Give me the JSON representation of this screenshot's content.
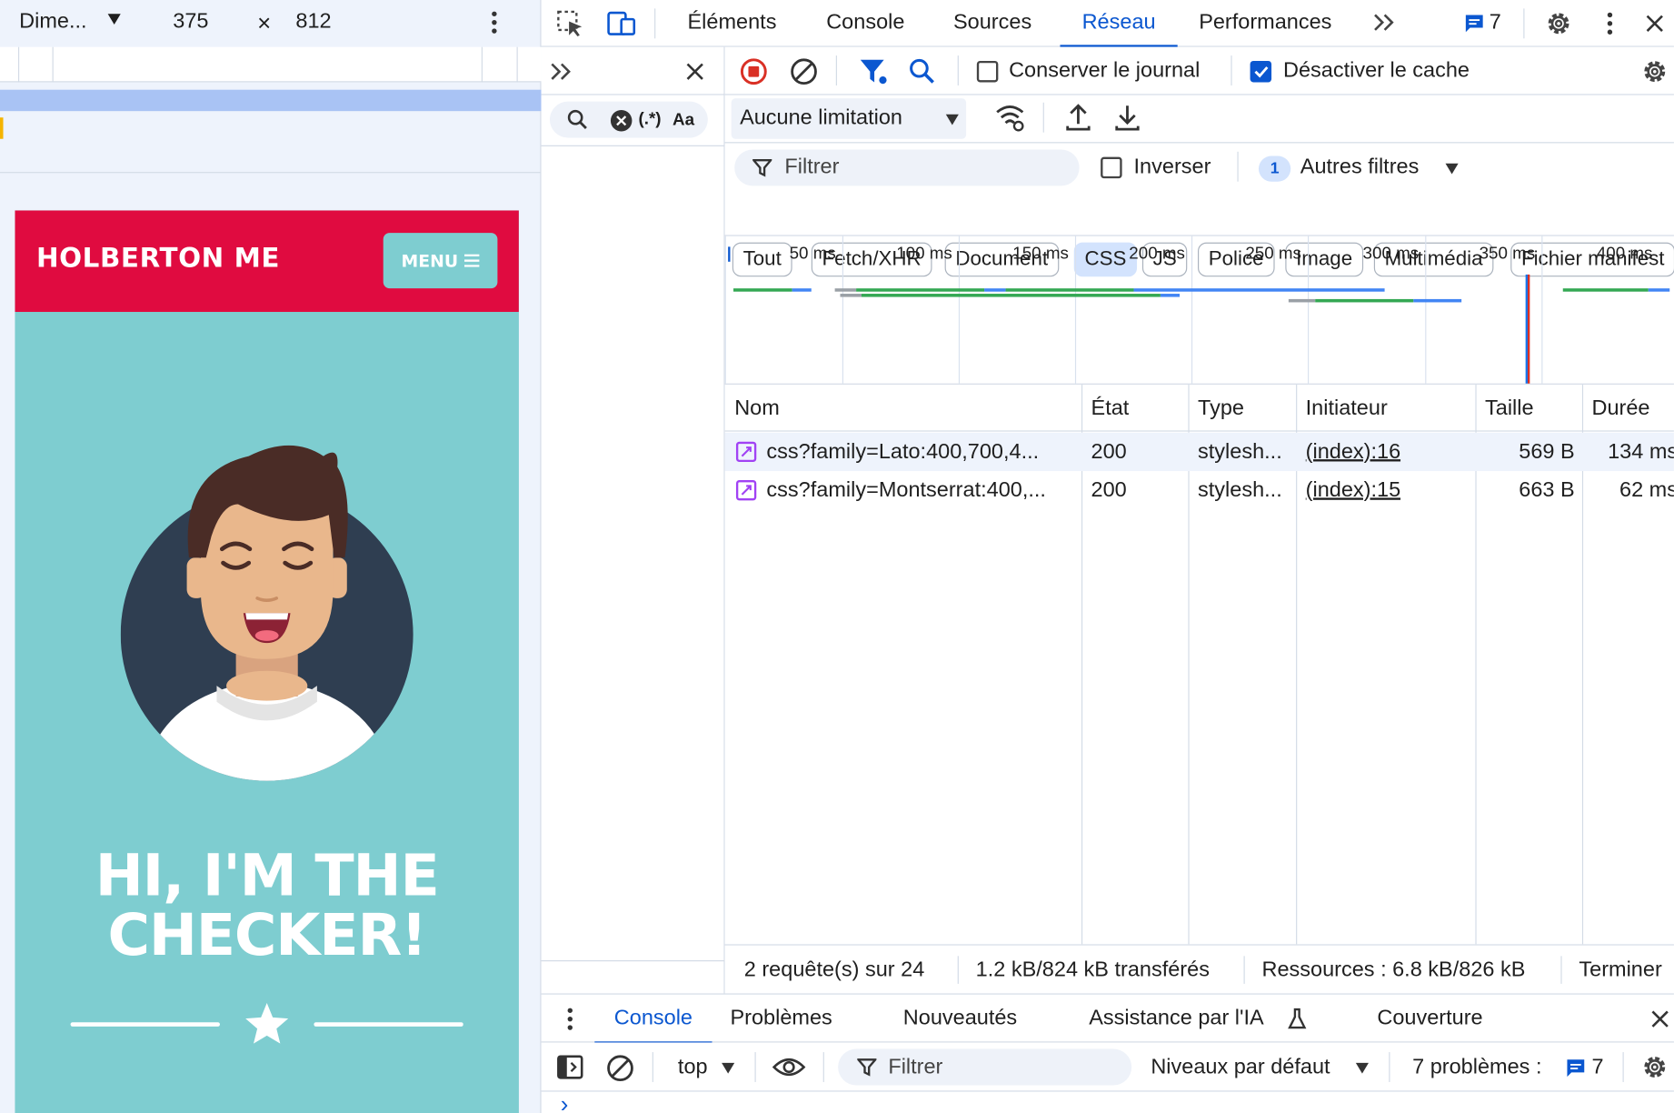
{
  "device_toolbar": {
    "device": "Dime...",
    "width": "375",
    "times": "×",
    "height": "812"
  },
  "site": {
    "brand": "HOLBERTON ME",
    "menu_label": "MENU",
    "hero_line1": "HI, I'M THE",
    "hero_line2": "CHECKER!",
    "colors": {
      "nav": "#e00b40",
      "teal": "#7ecdd0"
    }
  },
  "devtools": {
    "tabs": [
      "Éléments",
      "Console",
      "Sources",
      "Réseau",
      "Performances"
    ],
    "active_tab": "Réseau",
    "issues_count": "7",
    "search": {
      "regex": "(.*)",
      "case": "Aa"
    },
    "network": {
      "preserve_log": "Conserver le journal",
      "disable_cache": "Désactiver le cache",
      "throttling": "Aucune limitation",
      "filter_placeholder": "Filtrer",
      "invert": "Inverser",
      "more_filters_count": "1",
      "more_filters": "Autres filtres",
      "type_filters": [
        "Tout",
        "Fetch/XHR",
        "Document",
        "CSS",
        "JS",
        "Police",
        "Image",
        "Multimédia",
        "Fichier manifest"
      ],
      "active_type": "CSS",
      "timeline_ticks": [
        "50 ms",
        "100 ms",
        "150 ms",
        "200 ms",
        "250 ms",
        "300 ms",
        "350 ms",
        "400 ms"
      ],
      "columns": [
        "Nom",
        "État",
        "Type",
        "Initiateur",
        "Taille",
        "Durée"
      ],
      "rows": [
        {
          "name": "css?family=Lato:400,700,4...",
          "status": "200",
          "type": "stylesh...",
          "initiator": "(index):16",
          "size": "569 B",
          "time": "134 ms"
        },
        {
          "name": "css?family=Montserrat:400,...",
          "status": "200",
          "type": "stylesh...",
          "initiator": "(index):15",
          "size": "663 B",
          "time": "62 ms"
        }
      ],
      "summary": {
        "requests": "2 requête(s) sur 24",
        "transferred": "1.2 kB/824 kB transférés",
        "resources": "Ressources : 6.8 kB/826 kB",
        "finish": "Terminer"
      }
    },
    "drawer": {
      "tabs": [
        "Console",
        "Problèmes",
        "Nouveautés",
        "Assistance par l'IA",
        "Couverture"
      ],
      "active_tab": "Console",
      "context": "top",
      "filter_placeholder": "Filtrer",
      "levels": "Niveaux par défaut",
      "issues_label": "7 problèmes :",
      "issues_count": "7",
      "prompt": "›"
    }
  }
}
